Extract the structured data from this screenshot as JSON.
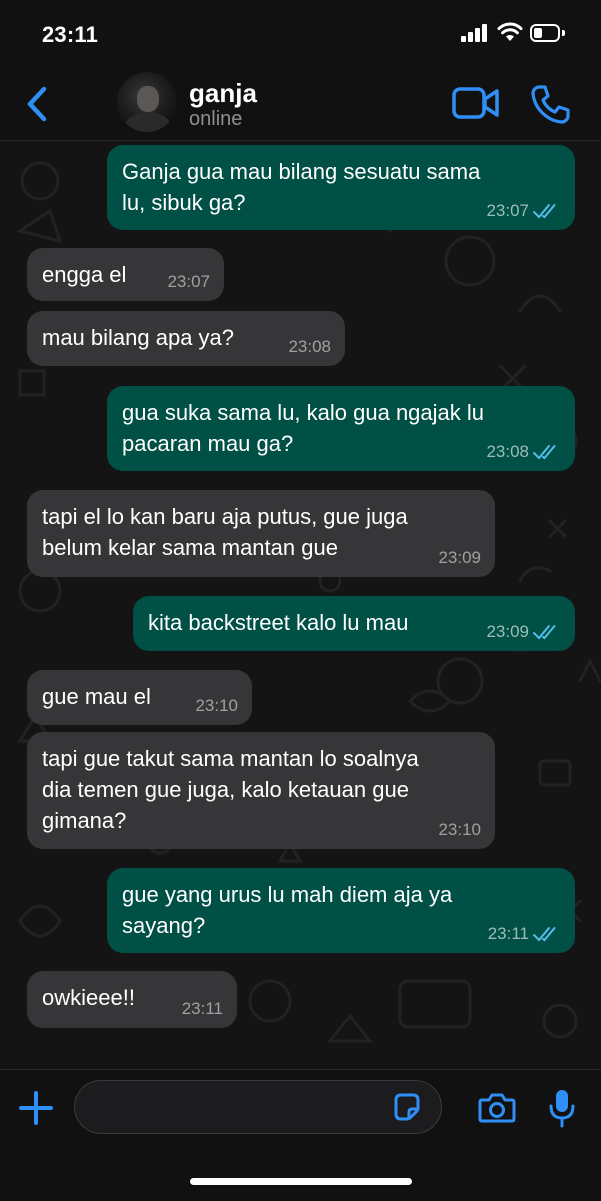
{
  "status_bar": {
    "time": "23:11",
    "battery_level": 0.35
  },
  "header": {
    "contact_name": "ganja",
    "contact_status": "online"
  },
  "colors": {
    "accent": "#2f8ff6",
    "outgoing_bubble": "#005046",
    "incoming_bubble": "#363638",
    "read_ticks": "#53bdeb"
  },
  "messages": [
    {
      "text": "Ganja gua mau bilang sesuatu sama\nlu, sibuk ga?",
      "time": "23:07",
      "direction": "outgoing",
      "read": true
    },
    {
      "text": "engga el",
      "time": "23:07",
      "direction": "incoming"
    },
    {
      "text": "mau bilang apa ya?",
      "time": "23:08",
      "direction": "incoming"
    },
    {
      "text": "gua suka sama lu, kalo gua ngajak lu\npacaran mau ga?",
      "time": "23:08",
      "direction": "outgoing",
      "read": true
    },
    {
      "text": "tapi el lo kan baru aja putus, gue juga\nbelum kelar sama mantan gue",
      "time": "23:09",
      "direction": "incoming"
    },
    {
      "text": "kita backstreet kalo lu mau",
      "time": "23:09",
      "direction": "outgoing",
      "read": true
    },
    {
      "text": "gue mau el",
      "time": "23:10",
      "direction": "incoming"
    },
    {
      "text": "tapi gue takut sama mantan lo soalnya\ndia temen gue juga, kalo ketauan gue\ngimana?",
      "time": "23:10",
      "direction": "incoming"
    },
    {
      "text": "gue yang urus lu mah diem aja ya\nsayang?",
      "time": "23:11",
      "direction": "outgoing",
      "read": true
    },
    {
      "text": "owkieee!!",
      "time": "23:11",
      "direction": "incoming"
    }
  ],
  "input": {
    "value": "",
    "placeholder": ""
  },
  "icons": {
    "back": "chevron-left-icon",
    "video": "video-camera-icon",
    "phone": "phone-icon",
    "plus": "plus-icon",
    "sticker": "sticker-icon",
    "camera": "camera-icon",
    "mic": "microphone-icon"
  }
}
